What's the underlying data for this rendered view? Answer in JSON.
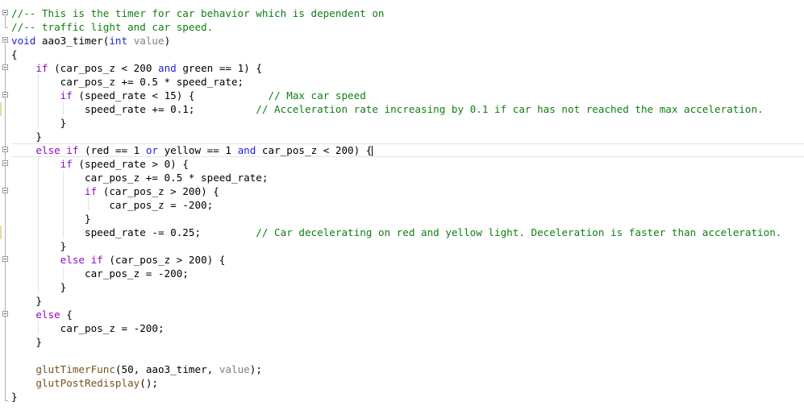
{
  "editor": {
    "lines": [
      {
        "id": "l1",
        "tokens": [
          {
            "t": "cm",
            "v": "//-- This is the timer for car behavior which is dependent on"
          }
        ]
      },
      {
        "id": "l2",
        "tokens": [
          {
            "t": "cm",
            "v": "//-- traffic light and car speed."
          }
        ]
      },
      {
        "id": "l3",
        "tokens": [
          {
            "t": "kw",
            "v": "void"
          },
          {
            "t": "x",
            "v": " aao3_timer("
          },
          {
            "t": "kw",
            "v": "int"
          },
          {
            "t": "x",
            "v": " "
          },
          {
            "t": "pm",
            "v": "value"
          },
          {
            "t": "x",
            "v": ")"
          }
        ]
      },
      {
        "id": "l4",
        "tokens": [
          {
            "t": "x",
            "v": "{"
          }
        ]
      },
      {
        "id": "l5",
        "tokens": [
          {
            "t": "x",
            "v": "    "
          },
          {
            "t": "ctl",
            "v": "if"
          },
          {
            "t": "x",
            "v": " (car_pos_z < 200 "
          },
          {
            "t": "kw",
            "v": "and"
          },
          {
            "t": "x",
            "v": " green == 1) {"
          }
        ]
      },
      {
        "id": "l6",
        "tokens": [
          {
            "t": "x",
            "v": "        car_pos_z += 0.5 * speed_rate;"
          }
        ]
      },
      {
        "id": "l7",
        "tokens": [
          {
            "t": "x",
            "v": "        "
          },
          {
            "t": "ctl",
            "v": "if"
          },
          {
            "t": "x",
            "v": " (speed_rate < 15) {            "
          },
          {
            "t": "cm",
            "v": "// Max car speed"
          }
        ]
      },
      {
        "id": "l8",
        "tokens": [
          {
            "t": "x",
            "v": "            speed_rate += 0.1;          "
          },
          {
            "t": "cm",
            "v": "// Acceleration rate increasing by 0.1 if car has not reached the max acceleration."
          }
        ]
      },
      {
        "id": "l9",
        "tokens": [
          {
            "t": "x",
            "v": "        }"
          }
        ]
      },
      {
        "id": "l10",
        "tokens": [
          {
            "t": "x",
            "v": "    }"
          }
        ]
      },
      {
        "id": "l11",
        "tokens": [
          {
            "t": "x",
            "v": "    "
          },
          {
            "t": "ctl",
            "v": "else if"
          },
          {
            "t": "x",
            "v": " (red == 1 "
          },
          {
            "t": "kw",
            "v": "or"
          },
          {
            "t": "x",
            "v": " yellow == 1 "
          },
          {
            "t": "kw",
            "v": "and"
          },
          {
            "t": "x",
            "v": " car_pos_z < 200) {"
          }
        ]
      },
      {
        "id": "l12",
        "tokens": [
          {
            "t": "x",
            "v": "        "
          },
          {
            "t": "ctl",
            "v": "if"
          },
          {
            "t": "x",
            "v": " (speed_rate > 0) {"
          }
        ]
      },
      {
        "id": "l13",
        "tokens": [
          {
            "t": "x",
            "v": "            car_pos_z += 0.5 * speed_rate;"
          }
        ]
      },
      {
        "id": "l14",
        "tokens": [
          {
            "t": "x",
            "v": "            "
          },
          {
            "t": "ctl",
            "v": "if"
          },
          {
            "t": "x",
            "v": " (car_pos_z > 200) {"
          }
        ]
      },
      {
        "id": "l15",
        "tokens": [
          {
            "t": "x",
            "v": "                car_pos_z = -200;"
          }
        ]
      },
      {
        "id": "l16",
        "tokens": [
          {
            "t": "x",
            "v": "            }"
          }
        ]
      },
      {
        "id": "l17",
        "tokens": [
          {
            "t": "x",
            "v": "            speed_rate -= 0.25;         "
          },
          {
            "t": "cm",
            "v": "// Car decelerating on red and yellow light. Deceleration is faster than acceleration."
          }
        ]
      },
      {
        "id": "l18",
        "tokens": [
          {
            "t": "x",
            "v": "        }"
          }
        ]
      },
      {
        "id": "l19",
        "tokens": [
          {
            "t": "x",
            "v": "        "
          },
          {
            "t": "ctl",
            "v": "else if"
          },
          {
            "t": "x",
            "v": " (car_pos_z > 200) {"
          }
        ]
      },
      {
        "id": "l20",
        "tokens": [
          {
            "t": "x",
            "v": "            car_pos_z = -200;"
          }
        ]
      },
      {
        "id": "l21",
        "tokens": [
          {
            "t": "x",
            "v": "        }"
          }
        ]
      },
      {
        "id": "l22",
        "tokens": [
          {
            "t": "x",
            "v": "    }"
          }
        ]
      },
      {
        "id": "l23",
        "tokens": [
          {
            "t": "x",
            "v": "    "
          },
          {
            "t": "ctl",
            "v": "else"
          },
          {
            "t": "x",
            "v": " {"
          }
        ]
      },
      {
        "id": "l24",
        "tokens": [
          {
            "t": "x",
            "v": "        car_pos_z = -200;"
          }
        ]
      },
      {
        "id": "l25",
        "tokens": [
          {
            "t": "x",
            "v": "    }"
          }
        ]
      },
      {
        "id": "l26",
        "tokens": []
      },
      {
        "id": "l27",
        "tokens": [
          {
            "t": "x",
            "v": "    "
          },
          {
            "t": "fn",
            "v": "glutTimerFunc"
          },
          {
            "t": "x",
            "v": "(50, aao3_timer, "
          },
          {
            "t": "pm",
            "v": "value"
          },
          {
            "t": "x",
            "v": ");"
          }
        ]
      },
      {
        "id": "l28",
        "tokens": [
          {
            "t": "x",
            "v": "    "
          },
          {
            "t": "fn",
            "v": "glutPostRedisplay"
          },
          {
            "t": "x",
            "v": "();"
          }
        ]
      },
      {
        "id": "l29",
        "tokens": [
          {
            "t": "x",
            "v": "}"
          }
        ]
      }
    ],
    "current_line": "l11",
    "icons": {
      "fold": "collapse-minus-icon"
    },
    "colors": {
      "keyword": "#1f1fd6",
      "control": "#8f08c4",
      "comment": "#0f7f12",
      "parameter": "#808080",
      "function": "#74531f"
    }
  }
}
